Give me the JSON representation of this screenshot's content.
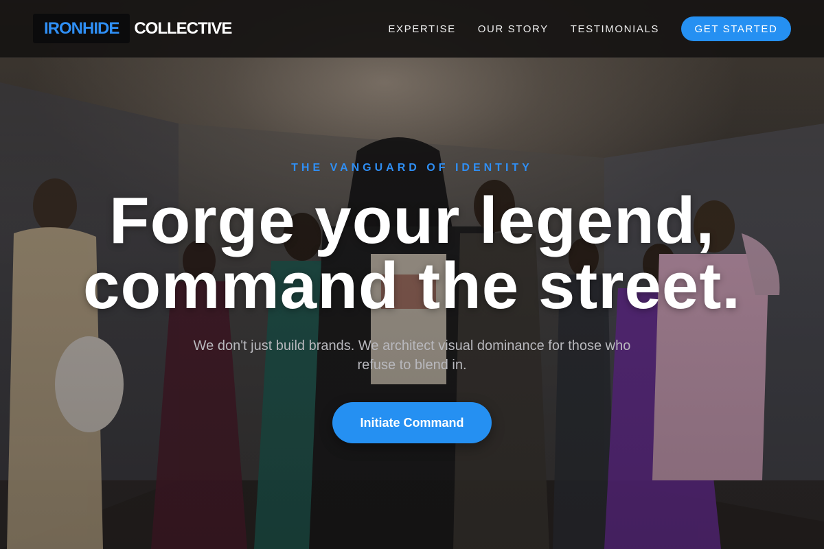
{
  "brand": {
    "logo_box_text": "IRONHIDE",
    "logo_word": "COLLECTIVE"
  },
  "nav": {
    "items": [
      {
        "label": "EXPERTISE"
      },
      {
        "label": "OUR STORY"
      },
      {
        "label": "TESTIMONIALS"
      }
    ],
    "cta_label": "GET STARTED"
  },
  "hero": {
    "eyebrow": "THE VANGUARD OF IDENTITY",
    "headline_line1": "Forge your legend,",
    "headline_line2": "command the street.",
    "subtext": "We don't just build brands. We architect visual dominance for those who refuse to blend in.",
    "cta_label": "Initiate Command",
    "background_image": "fashion-group-photo"
  },
  "colors": {
    "accent": "#2590f2",
    "nav_background": "#161412",
    "text_primary": "#ffffff",
    "text_muted": "#b8b8bd"
  }
}
